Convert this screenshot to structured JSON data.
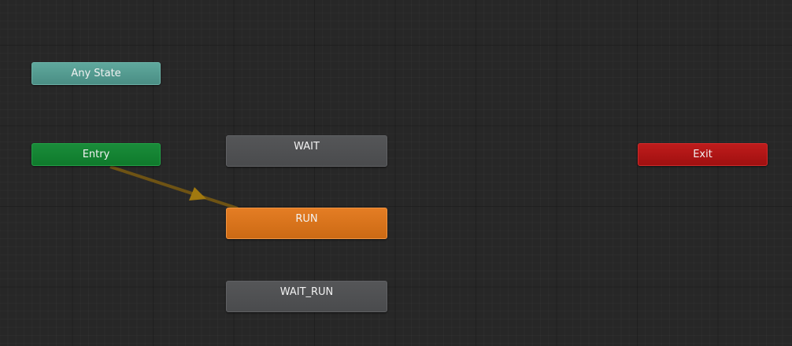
{
  "nodes": {
    "any_state": {
      "label": "Any State"
    },
    "entry": {
      "label": "Entry"
    },
    "exit": {
      "label": "Exit"
    },
    "wait": {
      "label": "WAIT"
    },
    "run": {
      "label": "RUN"
    },
    "wait_run": {
      "label": "WAIT_RUN"
    }
  },
  "colors": {
    "background": "#272727",
    "any_state": "#56a096",
    "entry": "#138434",
    "exit": "#b11616",
    "state": "#4f5052",
    "default_state": "#d97420",
    "transition": "#7a5a14"
  }
}
